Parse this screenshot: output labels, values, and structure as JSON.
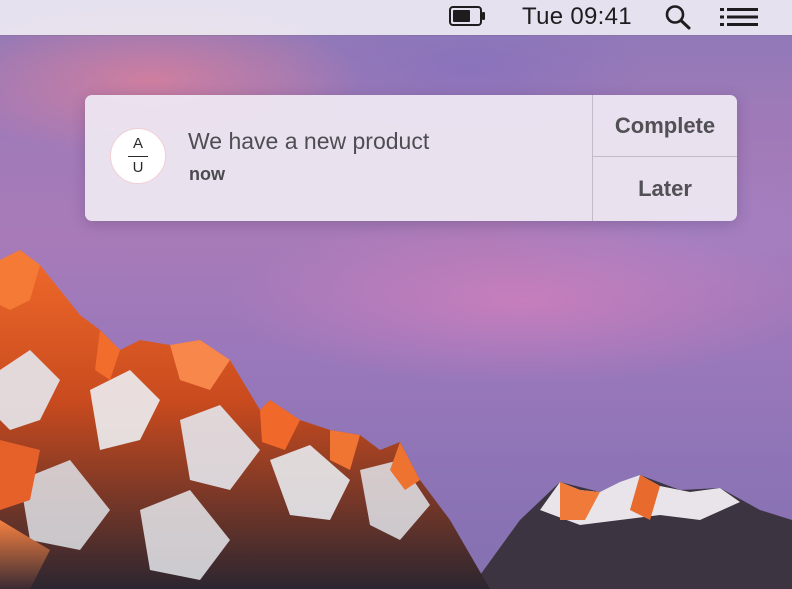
{
  "menubar": {
    "clock": "Tue 09:41",
    "icons": [
      "battery-icon",
      "search-icon",
      "list-icon"
    ]
  },
  "notification": {
    "avatar": {
      "top_letter": "A",
      "bottom_letter": "U"
    },
    "title": "We have a new product",
    "time": "now",
    "actions": {
      "primary": "Complete",
      "secondary": "Later"
    }
  },
  "colors": {
    "menubar_bg": "#eeeaf2",
    "notification_bg": "#eee8f2",
    "text_primary": "#4d4d52",
    "sky": "#9e7ab8"
  }
}
